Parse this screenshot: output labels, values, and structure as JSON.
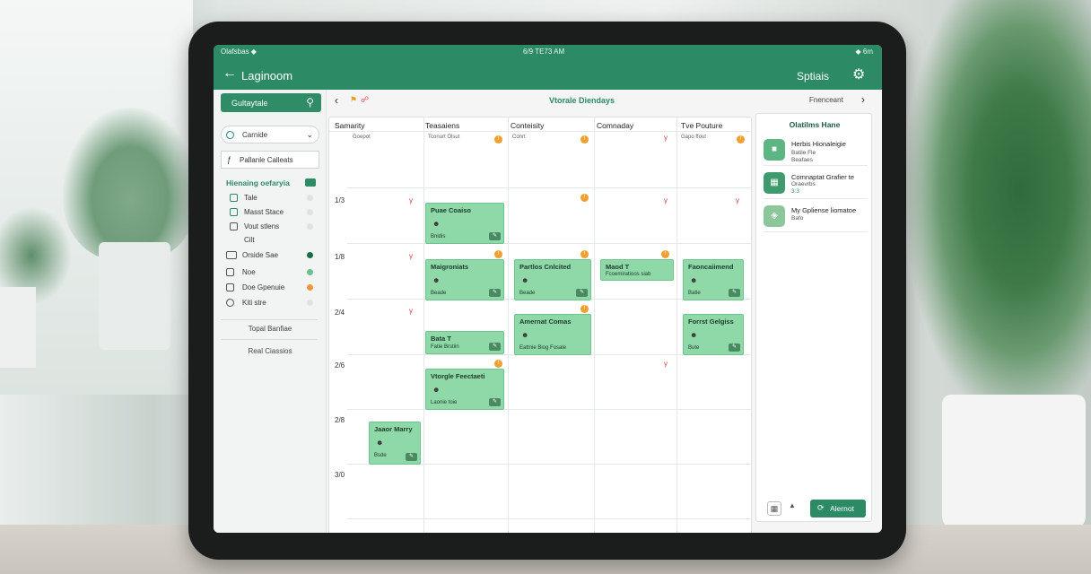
{
  "status_bar": {
    "left": "Olafsbas ◆",
    "center": "6/9 TE73 AM",
    "right": "◆ 6m"
  },
  "app_bar": {
    "title": "Laginoom",
    "options_label": "Sptiais"
  },
  "sidebar": {
    "search_label": "Gultaytale",
    "select_value": "Carnide",
    "filter_label": "Pallanle Calleats",
    "section_title": "Hienaing oefaryia",
    "items": [
      {
        "label": "Tale",
        "dot_color": "#dde3e0"
      },
      {
        "label": "Masst Stace",
        "dot_color": "#dde3e0"
      },
      {
        "label": "Vout stlens",
        "dot_color": "#dde3e0"
      },
      {
        "label": "Cilt"
      },
      {
        "label": "Orside Sae",
        "dot_color": "#1d6a46"
      },
      {
        "label": "Noe",
        "dot_color": "#6dbf8d"
      },
      {
        "label": "Doe Gpenuie",
        "dot_color": "#f0963a"
      },
      {
        "label": "Kiti stre",
        "dot_color": "#dde3e0"
      }
    ],
    "link1": "Topal Banfiae",
    "link2": "Real Ciassios"
  },
  "calendar": {
    "title": "Vtorale Diendays",
    "right_label": "Fnenceant",
    "columns": [
      "Samarity",
      "Teasaiens",
      "Conteisity",
      "Comnaday",
      "Tve Pouture"
    ],
    "col_subs": [
      "Goepot",
      "Tconurt Olsut",
      "Conrt",
      "",
      "Gapo ffout"
    ],
    "rows": [
      "1/3",
      "1/8",
      "2/4",
      "2/6",
      "2/8",
      "3/0"
    ],
    "events": [
      {
        "title": "Puae Coaiso",
        "sub": "Bnldis"
      },
      {
        "title": "Maigroniats",
        "sub": "Beade"
      },
      {
        "title": "Partlos Cnlcited",
        "sub": "Beade"
      },
      {
        "title": "Maod T",
        "sub": "Fcoemiratioos siab"
      },
      {
        "title": "Faoncaiimend",
        "sub": "Batle"
      },
      {
        "title": "Bata T",
        "sub": "Fatie Brstiin"
      },
      {
        "title": "Amernat Comas",
        "sub": "Eattnie Biog Fosale"
      },
      {
        "title": "Forrst Gelgiss",
        "sub": "Bute"
      },
      {
        "title": "Vtorgle Feectaeti",
        "sub": "Laonie toie"
      },
      {
        "title": "Jaaor Marry",
        "sub": "Bsde"
      }
    ]
  },
  "right_panel": {
    "title": "Olatilms Hane",
    "items": [
      {
        "name": "Herbis Hionaleigie",
        "sub1": "Batile Fle",
        "sub2": "Beafaes"
      },
      {
        "name": "Comnaptat Grafier te",
        "sub1": "Oraevrbs",
        "sub2": "3:3"
      },
      {
        "name": "My Gpliense liomatoe",
        "sub1": "Bafo",
        "sub2": ""
      }
    ],
    "alert_label": "Alernot"
  },
  "colors": {
    "accent": "#2c8a64",
    "event_fill": "#8fd9a8",
    "badge": "#f0a030",
    "mark": "#d23a3a"
  }
}
